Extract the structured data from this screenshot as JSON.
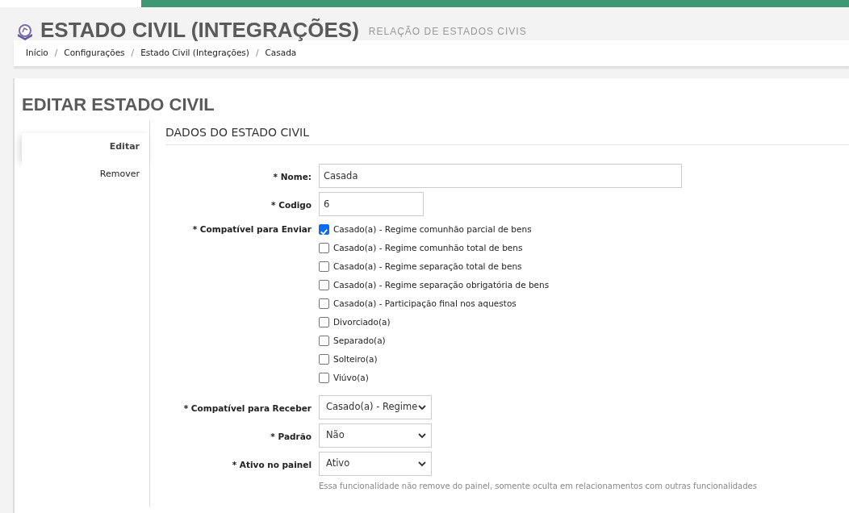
{
  "header": {
    "title": "ESTADO CIVIL (INTEGRAÇÕES)",
    "subtitle": "RELAÇÃO DE ESTADOS CIVIS"
  },
  "breadcrumb": [
    "Início",
    "Configurações",
    "Estado Civil (Integrações)",
    "Casada"
  ],
  "breadcrumb_separator": "/",
  "panel_title": "EDITAR ESTADO CIVIL",
  "side_tabs": [
    {
      "label": "Editar",
      "selected": true
    },
    {
      "label": "Remover",
      "selected": false
    }
  ],
  "section_title": "DADOS DO ESTADO CIVIL",
  "fields": [
    {
      "kind": "text",
      "label": "* Nome:",
      "value": "Casada",
      "wide": true
    },
    {
      "kind": "text",
      "label": "* Codigo",
      "value": "6",
      "wide": false
    },
    {
      "kind": "checks",
      "label": "* Compatível para Enviar",
      "options": [
        {
          "label": "Casado(a) - Regime comunhão parcial de bens",
          "checked": true
        },
        {
          "label": "Casado(a) - Regime comunhão total de bens",
          "checked": false
        },
        {
          "label": "Casado(a) - Regime separação total de bens",
          "checked": false
        },
        {
          "label": "Casado(a) - Regime separação obrigatória de bens",
          "checked": false
        },
        {
          "label": "Casado(a) - Participação final nos aquestos",
          "checked": false
        },
        {
          "label": "Divorciado(a)",
          "checked": false
        },
        {
          "label": "Separado(a)",
          "checked": false
        },
        {
          "label": "Solteiro(a)",
          "checked": false
        },
        {
          "label": "Viúvo(a)",
          "checked": false
        }
      ]
    },
    {
      "kind": "select",
      "label": "* Compatível para Receber",
      "value": "Casado(a) - Regime"
    },
    {
      "kind": "select",
      "label": "* Padrão",
      "value": "Não"
    },
    {
      "kind": "select",
      "label": "* Ativo no painel",
      "value": "Ativo",
      "help": "Essa funcionalidade não remove do painel, somente oculta em relacionamentos com outras funcionalidades"
    }
  ]
}
